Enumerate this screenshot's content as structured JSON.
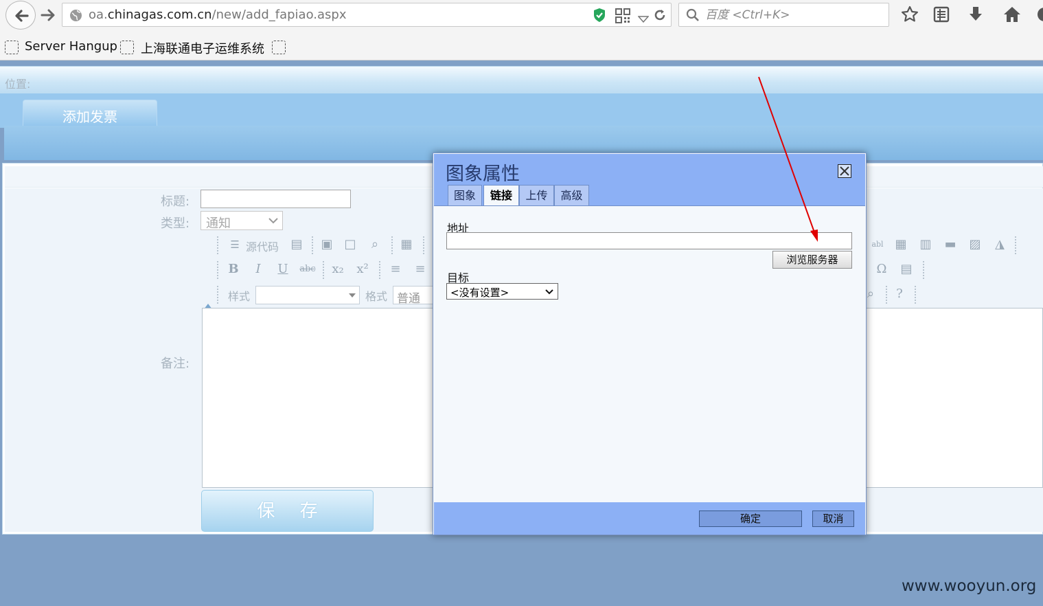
{
  "browser": {
    "url_prefix": "oa.",
    "url_domain": "chinagas.com.cn",
    "url_path": "/new/add_fapiao.aspx",
    "search_placeholder": "百度 <Ctrl+K>",
    "bookmarks": [
      "Server Hangup",
      "上海联通电子运维系统"
    ]
  },
  "page": {
    "location_label": "位置:",
    "tab_label": "添加发票",
    "form": {
      "title_label": "标题:",
      "type_label": "类型:",
      "type_value": "通知",
      "remark_label": "备注:",
      "save_label": "保 存"
    },
    "editor": {
      "source_label": "源代码",
      "style_label": "样式",
      "format_label": "格式",
      "format_value": "普通"
    }
  },
  "dialog": {
    "title": "图象属性",
    "tabs": [
      "图象",
      "链接",
      "上传",
      "高级"
    ],
    "active_tab": "链接",
    "address_label": "地址",
    "address_value": "",
    "browse_server_label": "浏览服务器",
    "target_label": "目标",
    "target_value": "<没有设置>",
    "ok_label": "确定",
    "cancel_label": "取消"
  },
  "watermark": "www.wooyun.org",
  "colors": {
    "dialog_header": "#8cb0f5",
    "page_background": "#80a0c6",
    "annotation_arrow": "#e00000"
  }
}
